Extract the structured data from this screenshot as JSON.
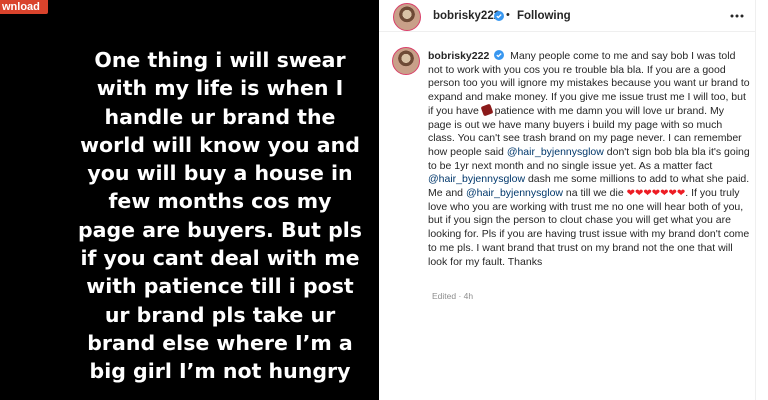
{
  "download_badge": "wnload",
  "story": {
    "text": "One thing i will swear\nwith my life is when I\nhandle ur brand the\nworld will know you and\nyou will buy a house in\nfew months cos my\npage are buyers. But pls\nif you cant deal with me\nwith patience till i post\nur brand pls take ur\nbrand else where I’m a\nbig girl I’m not hungry"
  },
  "header": {
    "username": "bobrisky222",
    "separator": "•",
    "follow_status": "Following",
    "more_icon": "ellipsis-icon"
  },
  "caption": {
    "username": "bobrisky222",
    "part1": "Many people come to me and say bob I was told not to work with you cos you re trouble bla bla. If you are a good person too you will ignore my mistakes because you want ur brand to expand and make money. If you give me issue trust me I will too, but if you have ",
    "part2": " patience with me damn you will love ur brand. My page is out we have many buyers i build my page with so much class. You can't see trash brand on my page never. I can remember how people said ",
    "mention1": "@hair_byjennysglow",
    "part3": " don't sign bob bla bla it's going to be 1yr next month and no single issue yet. As a matter fact ",
    "mention2": "@hair_byjennysglow",
    "part4": " dash me some millions to add to what she paid. Me and ",
    "mention3": "@hair_byjennysglow",
    "part5": " na till we die ",
    "hearts": "❤❤❤❤❤❤❤",
    "part6": ". If you truly love who you are working with trust me no one will hear both of you, but if you sign the person to clout chase you will get what you are looking for. Pls if you are having trust issue with my brand don't come to me pls. I want brand that trust on my brand not the one that will look for my fault. Thanks"
  },
  "edited": "Edited · 4h",
  "colors": {
    "verified": "#3897f0",
    "mention": "#00376b",
    "badge": "#d9432c"
  }
}
